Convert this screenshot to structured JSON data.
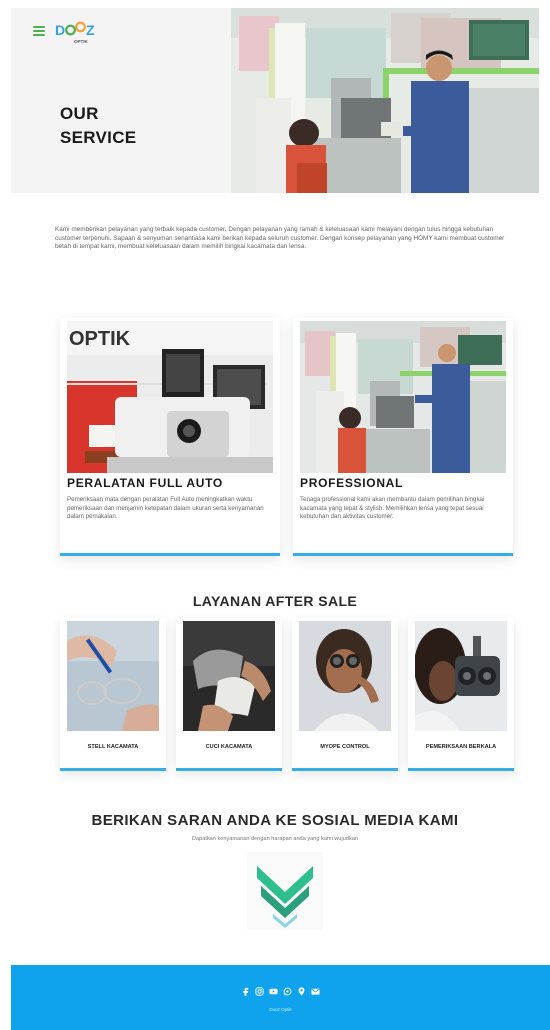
{
  "header": {
    "menu_icon": "hamburger-icon",
    "logo": {
      "main": "DOOZ",
      "sub": "OPTIK"
    },
    "title_line1": "OUR",
    "title_line2": "SERVICE"
  },
  "intro": "Kami memberikan pelayanan yang terbaik kepada customer. Dengan pelayanan yang ramah & keleluasaan kami melayani dengan tulus hingga kebutuhan customer terpenuhi. Sapaan & senyuman senantiasa kami berikan kepada seluruh customer. Dengan konsep pelayanan yang HOMY kami membuat customer betah di tempat kami, membuat keleluasaan dalam memilih bingkai kacamata dan lensa.",
  "services": [
    {
      "title": "PERALATAN FULL AUTO",
      "image_caption": "OPTIK",
      "desc": "Pemeriksaan mata dengan peralatan Full Auto meningkatkan waktu pemeriksaan dan menjamin ketepatan dalam ukuran serta kenyamanan dalam pemakaian."
    },
    {
      "title": "PROFESSIONAL",
      "desc": "Tenaga professional kami akan membantu dalam pemilihan bingkai kacamata yang tepat & stylish. Memilihkan lensa yang tepat sesuai kebutuhan dan aktivitas customer."
    }
  ],
  "aftersale": {
    "title": "LAYANAN AFTER SALE",
    "items": [
      {
        "label": "STELL KACAMATA"
      },
      {
        "label": "CUCI KACAMATA"
      },
      {
        "label": "MYOPE CONTROL"
      },
      {
        "label": "PEMERIKSAAN BERKALA"
      }
    ]
  },
  "social": {
    "title": "BERIKAN SARAN ANDA KE SOSIAL MEDIA KAMI",
    "subtitle": "Dapatkan kenyamanan dengan harapan anda yang kami wujudkan"
  },
  "footer": {
    "icons": [
      "facebook-icon",
      "instagram-icon",
      "youtube-icon",
      "whatsapp-icon",
      "location-icon",
      "email-icon"
    ],
    "brand": "Dooz Optik"
  },
  "colors": {
    "accent_blue": "#35aee3",
    "footer_bg": "#0ea3ec",
    "logo_green": "#4caf50",
    "chevron_green": "#2fbf8f"
  }
}
